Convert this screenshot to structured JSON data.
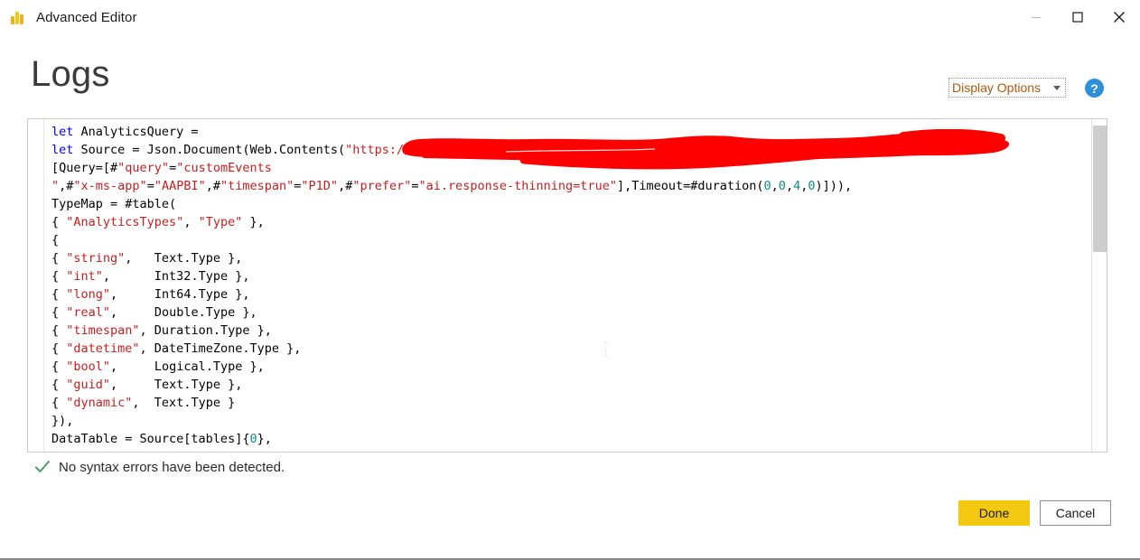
{
  "window": {
    "title": "Advanced Editor",
    "app_icon": "powerbi-logo-icon",
    "controls": {
      "minimize": "minimize-icon",
      "maximize": "maximize-icon",
      "close": "close-icon"
    }
  },
  "header": {
    "page_title": "Logs",
    "display_options": {
      "label": "Display Options",
      "caret": "chevron-down-icon"
    },
    "help": {
      "glyph": "?",
      "name": "help-icon"
    }
  },
  "editor": {
    "language": "M (Power Query)",
    "redaction": {
      "color": "#FF0000",
      "description": "red marker scribble covering the URL"
    },
    "scrollbar": {
      "thumb_top_pct": 2,
      "thumb_height_pct": 38
    },
    "lines": [
      [
        {
          "t": "let ",
          "c": "kw"
        },
        {
          "t": "AnalyticsQuery =",
          "c": "pl"
        }
      ],
      [
        {
          "t": "let ",
          "c": "kw"
        },
        {
          "t": "Source = Json.Document(Web.Contents(",
          "c": "pl"
        },
        {
          "t": "\"https://",
          "c": "str"
        }
      ],
      [
        {
          "t": "[Query=[#",
          "c": "pl"
        },
        {
          "t": "\"query\"",
          "c": "str"
        },
        {
          "t": "=",
          "c": "pl"
        },
        {
          "t": "\"customEvents",
          "c": "str"
        }
      ],
      [
        {
          "t": "\"",
          "c": "str"
        },
        {
          "t": ",#",
          "c": "pl"
        },
        {
          "t": "\"x-ms-app\"",
          "c": "str"
        },
        {
          "t": "=",
          "c": "pl"
        },
        {
          "t": "\"AAPBI\"",
          "c": "str"
        },
        {
          "t": ",#",
          "c": "pl"
        },
        {
          "t": "\"timespan\"",
          "c": "str"
        },
        {
          "t": "=",
          "c": "pl"
        },
        {
          "t": "\"P1D\"",
          "c": "str"
        },
        {
          "t": ",#",
          "c": "pl"
        },
        {
          "t": "\"prefer\"",
          "c": "str"
        },
        {
          "t": "=",
          "c": "pl"
        },
        {
          "t": "\"ai.response-thinning=true\"",
          "c": "str"
        },
        {
          "t": "],Timeout=#duration(",
          "c": "pl"
        },
        {
          "t": "0",
          "c": "num"
        },
        {
          "t": ",",
          "c": "pl"
        },
        {
          "t": "0",
          "c": "num"
        },
        {
          "t": ",",
          "c": "pl"
        },
        {
          "t": "4",
          "c": "num"
        },
        {
          "t": ",",
          "c": "pl"
        },
        {
          "t": "0",
          "c": "num"
        },
        {
          "t": ")])),",
          "c": "pl"
        }
      ],
      [
        {
          "t": "TypeMap = #table(",
          "c": "pl"
        }
      ],
      [
        {
          "t": "{ ",
          "c": "pl"
        },
        {
          "t": "\"AnalyticsTypes\"",
          "c": "str"
        },
        {
          "t": ", ",
          "c": "pl"
        },
        {
          "t": "\"Type\"",
          "c": "str"
        },
        {
          "t": " },",
          "c": "pl"
        }
      ],
      [
        {
          "t": "{",
          "c": "pl"
        }
      ],
      [
        {
          "t": "{ ",
          "c": "pl"
        },
        {
          "t": "\"string\"",
          "c": "str"
        },
        {
          "t": ",   Text.Type },",
          "c": "pl"
        }
      ],
      [
        {
          "t": "{ ",
          "c": "pl"
        },
        {
          "t": "\"int\"",
          "c": "str"
        },
        {
          "t": ",      Int32.Type },",
          "c": "pl"
        }
      ],
      [
        {
          "t": "{ ",
          "c": "pl"
        },
        {
          "t": "\"long\"",
          "c": "str"
        },
        {
          "t": ",     Int64.Type },",
          "c": "pl"
        }
      ],
      [
        {
          "t": "{ ",
          "c": "pl"
        },
        {
          "t": "\"real\"",
          "c": "str"
        },
        {
          "t": ",     Double.Type },",
          "c": "pl"
        }
      ],
      [
        {
          "t": "{ ",
          "c": "pl"
        },
        {
          "t": "\"timespan\"",
          "c": "str"
        },
        {
          "t": ", Duration.Type },",
          "c": "pl"
        }
      ],
      [
        {
          "t": "{ ",
          "c": "pl"
        },
        {
          "t": "\"datetime\"",
          "c": "str"
        },
        {
          "t": ", DateTimeZone.Type },",
          "c": "pl"
        }
      ],
      [
        {
          "t": "{ ",
          "c": "pl"
        },
        {
          "t": "\"bool\"",
          "c": "str"
        },
        {
          "t": ",     Logical.Type },",
          "c": "pl"
        }
      ],
      [
        {
          "t": "{ ",
          "c": "pl"
        },
        {
          "t": "\"guid\"",
          "c": "str"
        },
        {
          "t": ",     Text.Type },",
          "c": "pl"
        }
      ],
      [
        {
          "t": "{ ",
          "c": "pl"
        },
        {
          "t": "\"dynamic\"",
          "c": "str"
        },
        {
          "t": ",  Text.Type }",
          "c": "pl"
        }
      ],
      [
        {
          "t": "}),",
          "c": "pl"
        }
      ],
      [
        {
          "t": "DataTable = Source[tables]{",
          "c": "pl"
        },
        {
          "t": "0",
          "c": "num"
        },
        {
          "t": "},",
          "c": "pl"
        }
      ]
    ]
  },
  "status": {
    "icon": "checkmark-icon",
    "text": "No syntax errors have been detected."
  },
  "footer": {
    "done_label": "Done",
    "cancel_label": "Cancel"
  },
  "colors": {
    "accent_yellow": "#F2C811",
    "keyword_blue": "#0000FF",
    "string_red": "#C42020",
    "number_teal": "#0F8A8A",
    "redaction_red": "#FF0000",
    "success_green": "#4F9E63"
  }
}
